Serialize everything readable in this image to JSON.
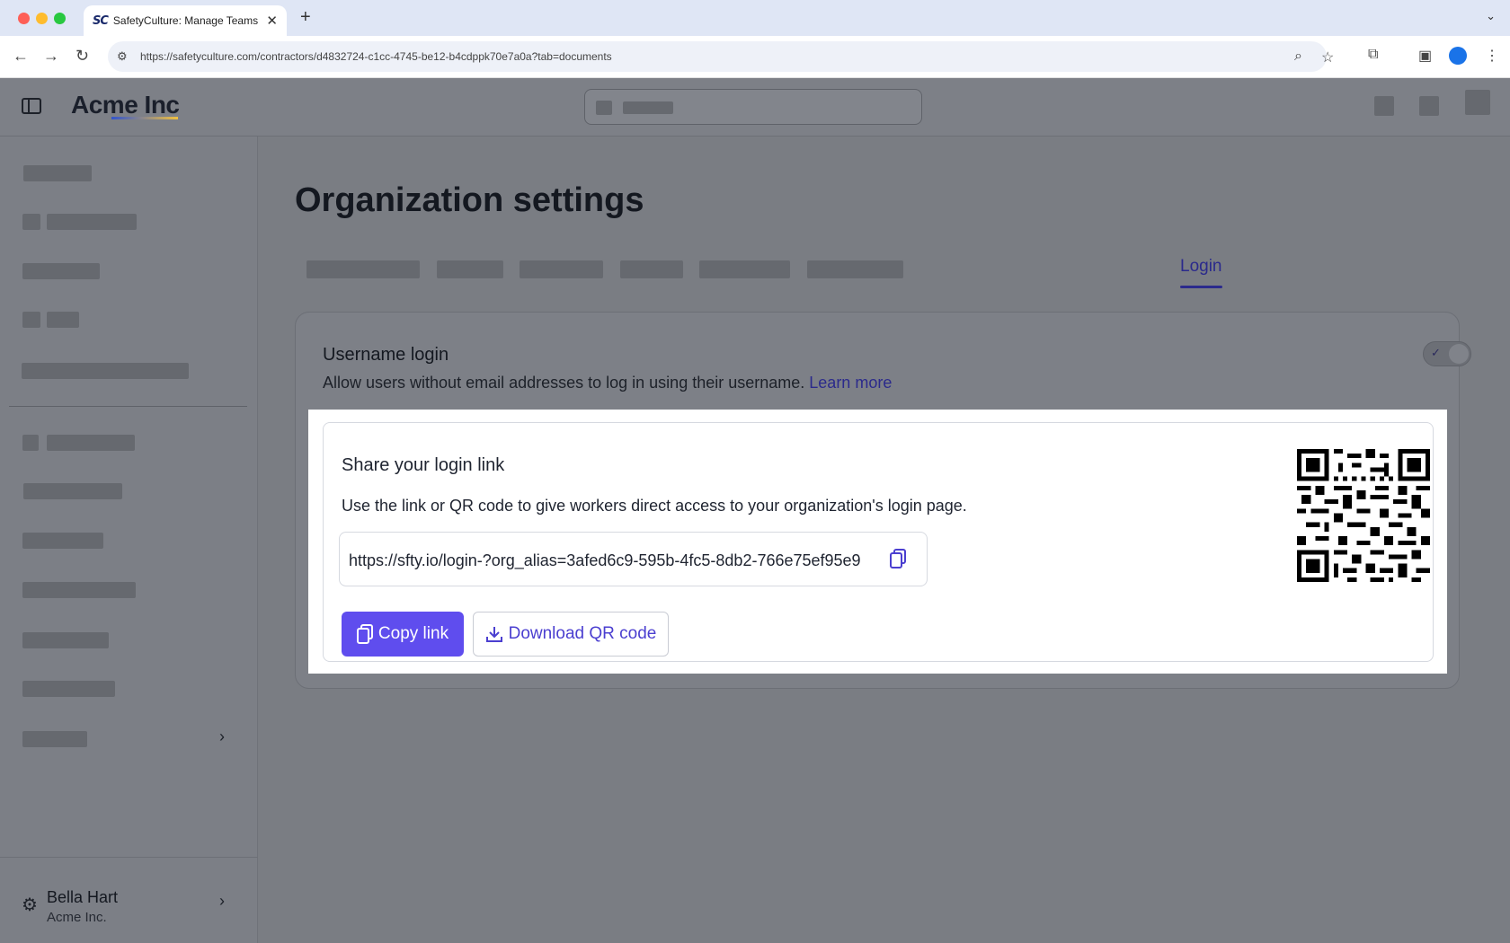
{
  "browser": {
    "tab_title": "SafetyCulture: Manage Teams and...",
    "tab_favicon": "SC",
    "url": "https://safetyculture.com/contractors/d4832724-c1cc-4745-be12-b4cdppk70e7a0a?tab=documents"
  },
  "app": {
    "brand": "Acme Inc"
  },
  "sidebar": {
    "user": {
      "name": "Bella Hart",
      "org": "Acme Inc."
    }
  },
  "main": {
    "page_title": "Organization settings",
    "active_tab": "Login",
    "username_login": {
      "title": "Username login",
      "description": "Allow users without email addresses to log in using their username.",
      "learn_more": "Learn more",
      "enabled": true
    },
    "share": {
      "title": "Share your login link",
      "description": "Use the link or QR code to give workers direct access to your organization's login page.",
      "link": "https://sfty.io/login-?org_alias=3afed6c9-595b-4fc5-8db2-766e75ef95e9",
      "copy_button": "Copy link",
      "download_button": "Download QR code"
    }
  },
  "colors": {
    "accent": "#5f4dee",
    "link": "#2b2a8c"
  }
}
